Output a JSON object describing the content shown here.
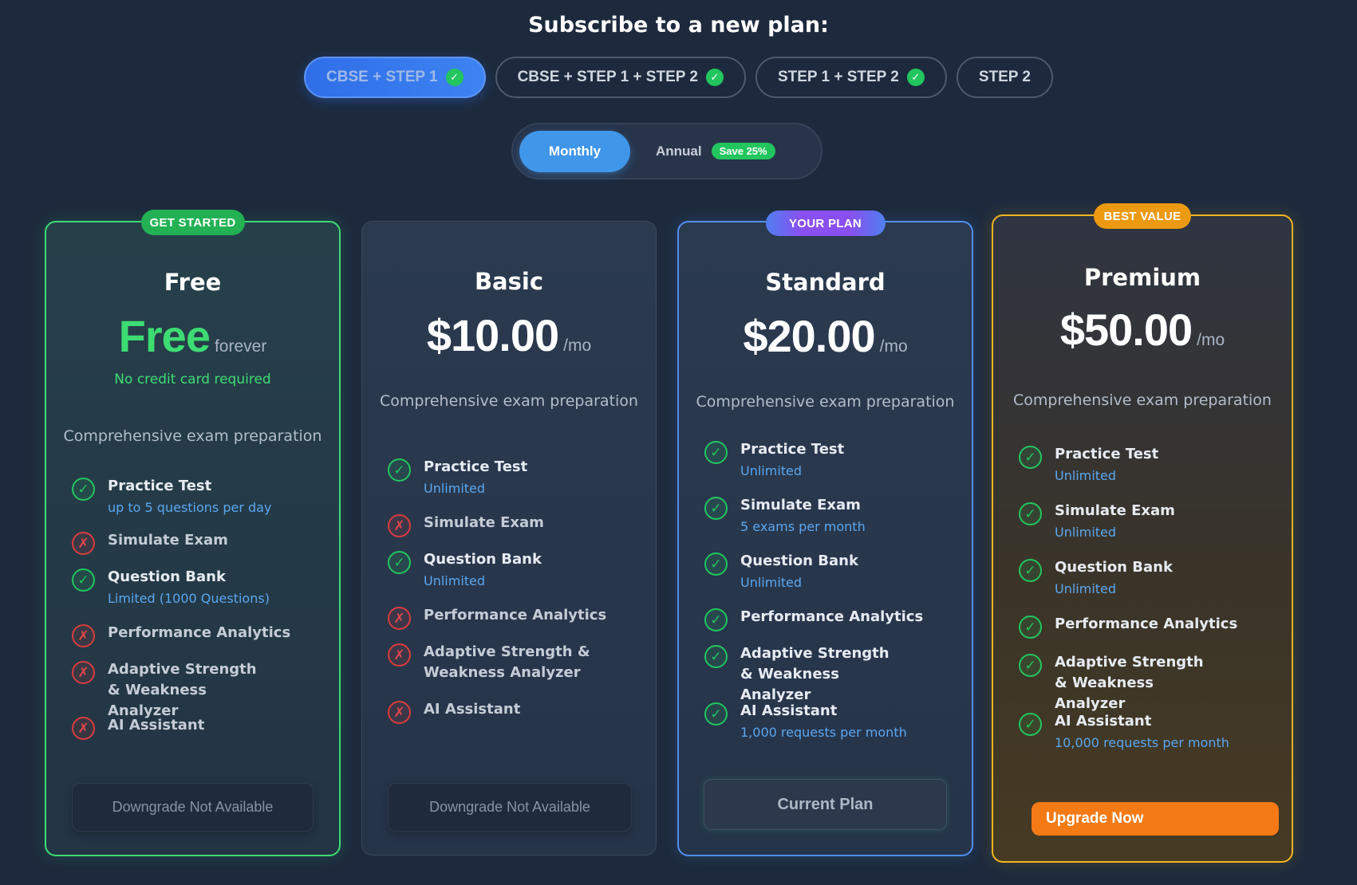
{
  "heading": "Subscribe to a new plan:",
  "courses": [
    {
      "label": "CBSE + STEP 1",
      "checked": true,
      "active": true
    },
    {
      "label": "CBSE + STEP 1 + STEP 2",
      "checked": true,
      "active": false
    },
    {
      "label": "STEP 1 + STEP 2",
      "checked": true,
      "active": false
    },
    {
      "label": "STEP 2",
      "checked": false,
      "active": false
    }
  ],
  "billing": {
    "monthly_label": "Monthly",
    "annual_label": "Annual",
    "save_badge": "Save 25%",
    "selected": "monthly"
  },
  "plans": {
    "free": {
      "ribbon": "GET STARTED",
      "name": "Free",
      "amount": "Free",
      "unit": "forever",
      "note": "No credit card required",
      "description": "Comprehensive exam preparation",
      "features": [
        {
          "label": "Practice Test",
          "included": true,
          "sub": "up to 5 questions per day"
        },
        {
          "label": "Simulate Exam",
          "included": false,
          "sub": ""
        },
        {
          "label": "Question Bank",
          "included": true,
          "sub": "Limited (1000 Questions)"
        },
        {
          "label": "Performance Analytics",
          "included": false,
          "sub": ""
        },
        {
          "label": "Adaptive Strength & Weakness Analyzer",
          "included": false,
          "sub": ""
        },
        {
          "label": "AI Assistant",
          "included": false,
          "sub": ""
        }
      ],
      "cta": "Downgrade Not Available"
    },
    "basic": {
      "name": "Basic",
      "amount": "$10.00",
      "unit": "/mo",
      "description": "Comprehensive exam preparation",
      "features": [
        {
          "label": "Practice Test",
          "included": true,
          "sub": "Unlimited"
        },
        {
          "label": "Simulate Exam",
          "included": false,
          "sub": ""
        },
        {
          "label": "Question Bank",
          "included": true,
          "sub": "Unlimited"
        },
        {
          "label": "Performance Analytics",
          "included": false,
          "sub": ""
        },
        {
          "label": "Adaptive Strength & Weakness Analyzer",
          "included": false,
          "sub": ""
        },
        {
          "label": "AI Assistant",
          "included": false,
          "sub": ""
        }
      ],
      "cta": "Downgrade Not Available"
    },
    "standard": {
      "ribbon": "YOUR PLAN",
      "name": "Standard",
      "amount": "$20.00",
      "unit": "/mo",
      "description": "Comprehensive exam preparation",
      "features": [
        {
          "label": "Practice Test",
          "included": true,
          "sub": "Unlimited"
        },
        {
          "label": "Simulate Exam",
          "included": true,
          "sub": "5 exams per month"
        },
        {
          "label": "Question Bank",
          "included": true,
          "sub": "Unlimited"
        },
        {
          "label": "Performance Analytics",
          "included": true,
          "sub": ""
        },
        {
          "label": "Adaptive Strength & Weakness Analyzer",
          "included": true,
          "sub": ""
        },
        {
          "label": "AI Assistant",
          "included": true,
          "sub": "1,000 requests per month"
        }
      ],
      "cta": "Current Plan"
    },
    "premium": {
      "ribbon": "BEST VALUE",
      "name": "Premium",
      "amount": "$50.00",
      "unit": "/mo",
      "description": "Comprehensive exam preparation",
      "features": [
        {
          "label": "Practice Test",
          "included": true,
          "sub": "Unlimited"
        },
        {
          "label": "Simulate Exam",
          "included": true,
          "sub": "Unlimited"
        },
        {
          "label": "Question Bank",
          "included": true,
          "sub": "Unlimited"
        },
        {
          "label": "Performance Analytics",
          "included": true,
          "sub": ""
        },
        {
          "label": "Adaptive Strength & Weakness Analyzer",
          "included": true,
          "sub": ""
        },
        {
          "label": "AI Assistant",
          "included": true,
          "sub": "10,000 requests per month"
        }
      ],
      "cta": "Upgrade Now"
    }
  },
  "icons": {
    "included": "check-icon",
    "excluded": "x-icon"
  },
  "colors": {
    "accent_blue": "#3d83f2",
    "success": "#22c55e",
    "error": "#d83c3c",
    "premium_gold": "#f2b41f",
    "upgrade_orange": "#f47a16"
  }
}
